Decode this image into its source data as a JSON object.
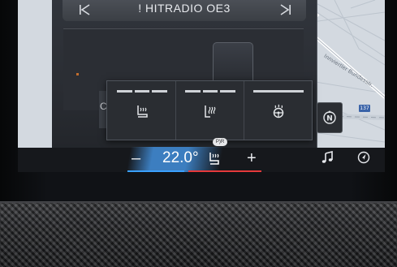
{
  "media": {
    "station": "! HITRADIO OE3",
    "left_tile_letter": "C"
  },
  "map": {
    "road_label": "Innviertler Bundesstr.",
    "route_number": "137"
  },
  "seat_popup": {
    "buttons": [
      {
        "name": "seat-heating",
        "icon": "seat-heat-icon",
        "level": 3
      },
      {
        "name": "backrest-heating",
        "icon": "backrest-heat-icon",
        "level": 3
      },
      {
        "name": "steering-wheel-heating",
        "icon": "steering-wheel-heat-icon",
        "level": 1
      }
    ]
  },
  "nav_button": {
    "icon": "north-up-compass-icon",
    "label": "N"
  },
  "climate": {
    "minus_label": "–",
    "temperature": "22.0°",
    "plus_label": "+",
    "pdc_label": "P)R"
  },
  "colors": {
    "accent_blue": "#3aa0ff",
    "accent_red": "#e5393b",
    "temp_band": "#3c7ec0"
  }
}
